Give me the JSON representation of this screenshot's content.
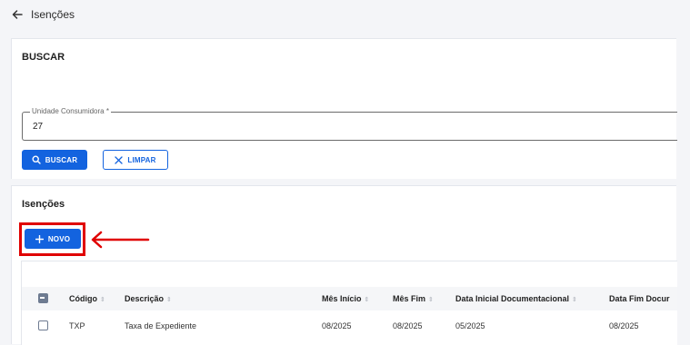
{
  "header": {
    "title": "Isenções"
  },
  "search": {
    "section_title": "BUSCAR",
    "field_label": "Unidade Consumidora *",
    "field_value": "27",
    "buscar_label": "BUSCAR",
    "limpar_label": "LIMPAR"
  },
  "list": {
    "section_title": "Isenções",
    "novo_label": "NOVO",
    "columns": [
      "Código",
      "Descrição",
      "Mês Início",
      "Mês Fim",
      "Data Inicial Documentacional",
      "Data Fim Docur"
    ],
    "rows": [
      {
        "codigo": "TXP",
        "descricao": "Taxa de Expediente",
        "mes_inicio": "08/2025",
        "mes_fim": "08/2025",
        "data_inicial": "05/2025",
        "data_fim": "08/2025"
      }
    ]
  },
  "colors": {
    "primary": "#1363df",
    "highlight": "#e00000"
  },
  "icons": [
    "arrow-left-icon",
    "search-icon",
    "close-icon",
    "plus-icon",
    "sort-icon",
    "red-arrow-annotation"
  ]
}
